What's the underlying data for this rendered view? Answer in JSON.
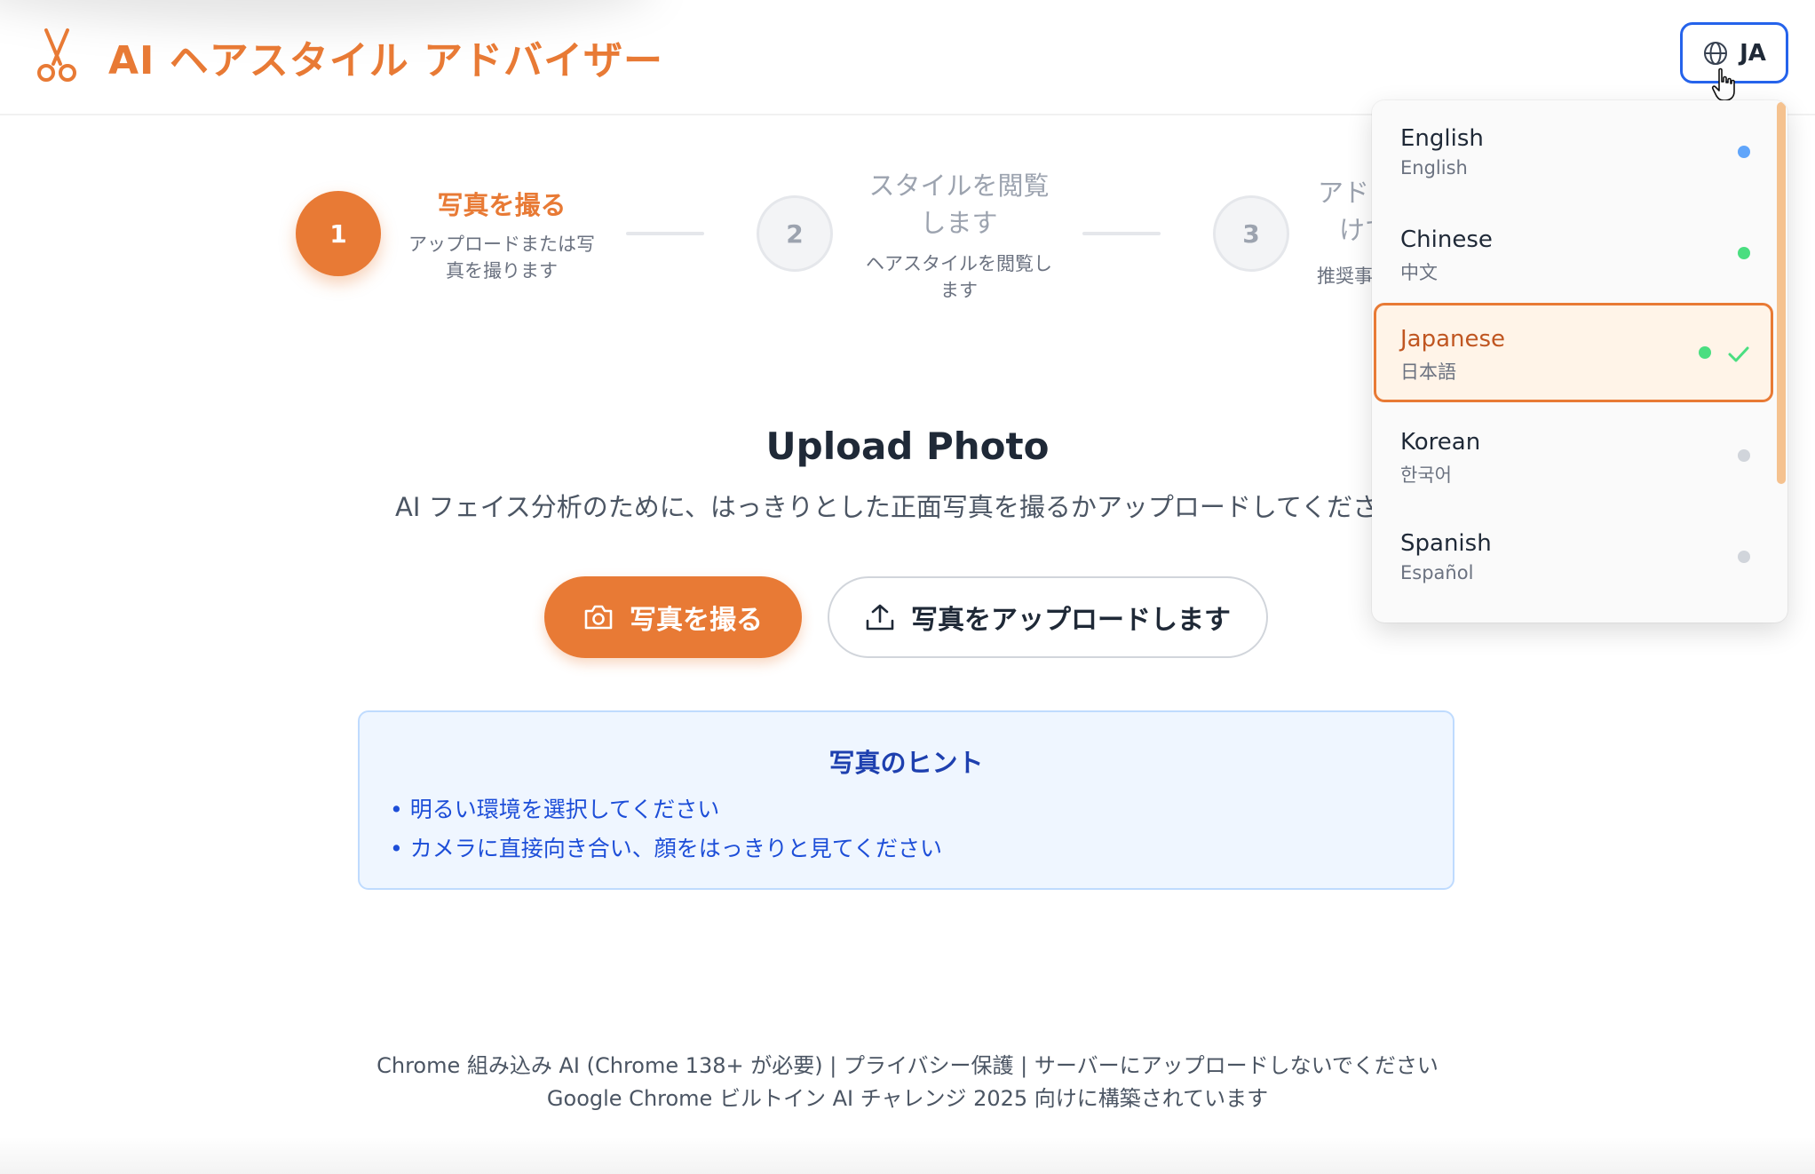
{
  "header": {
    "title": "AI ヘアスタイル アドバイザー",
    "language_button_label": "JA"
  },
  "steps": [
    {
      "number": "1",
      "title_lines": [
        "写真を撮る"
      ],
      "desc_lines": [
        "アップロードまたは写",
        "真を撮ります"
      ],
      "state": "active"
    },
    {
      "number": "2",
      "title_lines": [
        "スタイルを閲覧",
        "します"
      ],
      "desc_lines": [
        "ヘアスタイルを閲覧し",
        "ます"
      ],
      "state": "inactive"
    },
    {
      "number": "3",
      "title_lines": [
        "アド",
        "けて"
      ],
      "desc_lines": [
        "推奨事"
      ],
      "state": "inactive"
    }
  ],
  "upload": {
    "title": "Upload Photo",
    "subtitle": "AI フェイス分析のために、はっきりとした正面写真を撮るかアップロードしてください",
    "take_photo_label": "写真を撮る",
    "upload_photo_label": "写真をアップロードします"
  },
  "tips": {
    "title": "写真のヒント",
    "items": [
      "• 明るい環境を選択してください",
      "• カメラに直接向き合い、顔をはっきりと見てください"
    ]
  },
  "footer": {
    "line1": "Chrome 組み込み AI (Chrome 138+ が必要) | プライバシー保護 | サーバーにアップロードしないでください",
    "line2": "Google Chrome ビルトイン AI チャレンジ 2025 向けに構築されています"
  },
  "language_menu": {
    "selected": "Japanese",
    "items": [
      {
        "name": "English",
        "native": "English",
        "dot_color": "#60a5fa"
      },
      {
        "name": "Chinese",
        "native": "中文",
        "dot_color": "#4ade80"
      },
      {
        "name": "Japanese",
        "native": "日本語",
        "dot_color": "#4ade80"
      },
      {
        "name": "Korean",
        "native": "한국어",
        "dot_color": "#d1d5db"
      },
      {
        "name": "Spanish",
        "native": "Español",
        "dot_color": "#d1d5db"
      }
    ]
  },
  "colors": {
    "accent": "#e87a35",
    "focus_blue": "#2563eb",
    "tips_bg": "#eff6ff",
    "tips_text": "#1d4ed8"
  }
}
